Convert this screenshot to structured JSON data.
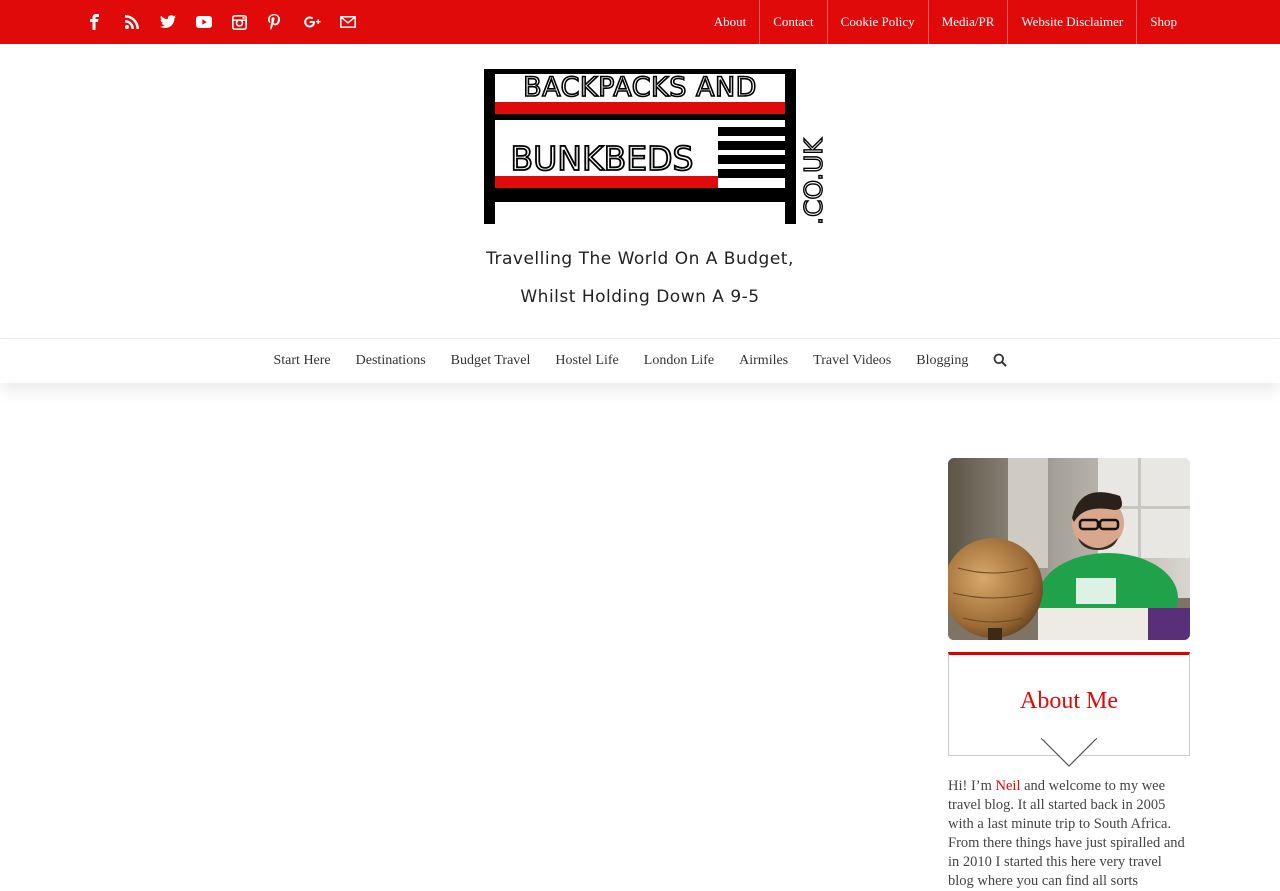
{
  "social": [
    {
      "icon": "facebook-icon"
    },
    {
      "icon": "rss-icon"
    },
    {
      "icon": "twitter-icon"
    },
    {
      "icon": "youtube-icon"
    },
    {
      "icon": "instagram-icon"
    },
    {
      "icon": "pinterest-icon"
    },
    {
      "icon": "google-plus-icon"
    },
    {
      "icon": "email-icon"
    }
  ],
  "top_nav": [
    "About",
    "Contact",
    "Cookie Policy",
    "Media/PR",
    "Website Disclaimer",
    "Shop"
  ],
  "logo": {
    "line1": "BACKPACKS AND",
    "line2": "BUNKBEDS",
    "domain": ".CO.UK"
  },
  "tagline": {
    "line1": "Travelling The World On A Budget,",
    "line2": "Whilst Holding Down A 9-5"
  },
  "main_nav": [
    "Start Here",
    "Destinations",
    "Budget Travel",
    "Hostel Life",
    "London Life",
    "Airmiles",
    "Travel Videos",
    "Blogging"
  ],
  "sidebar": {
    "about_title": "About Me",
    "about_intro": "Hi! I’m ",
    "about_name": "Neil",
    "about_rest": " and welcome to my wee travel blog. It all started back in 2005 with a last minute trip to South Africa. From there things have just spiralled and in 2010 I started this here very travel blog where you can find all sorts"
  },
  "colors": {
    "accent": "#e10a0a"
  }
}
